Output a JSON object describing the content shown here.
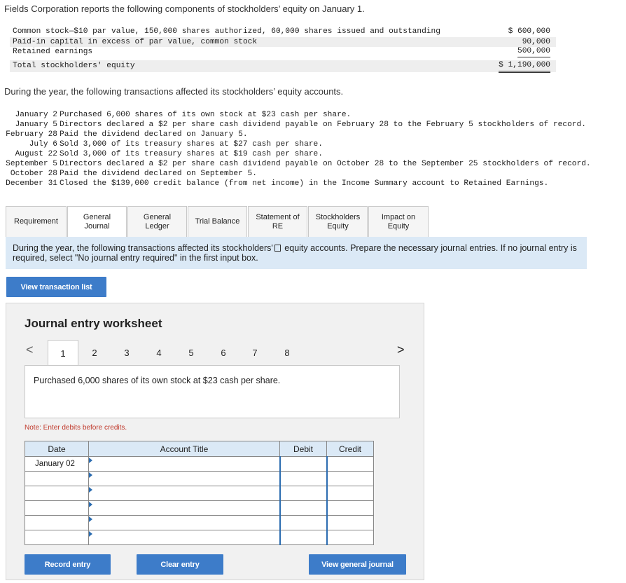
{
  "intro": "Fields Corporation reports the following components of stockholders’ equity on January 1.",
  "equity": [
    {
      "label": "Common stock—$10 par value, 150,000 shares authorized, 60,000 shares issued and outstanding",
      "amount": "$ 600,000"
    },
    {
      "label": "Paid-in capital in excess of par value, common stock",
      "amount": "90,000"
    },
    {
      "label": "Retained earnings",
      "amount": "500,000"
    },
    {
      "label": "Total stockholders' equity",
      "amount": "$ 1,190,000"
    }
  ],
  "during_text": "During the year, the following transactions affected its stockholders’ equity accounts.",
  "transactions": [
    {
      "date": "January 2",
      "text": "Purchased 6,000 shares of its own stock at $23 cash per share."
    },
    {
      "date": "January 5",
      "text": "Directors declared a $2 per share cash dividend payable on February 28 to the February 5 stockholders of record."
    },
    {
      "date": "February 28",
      "text": "Paid the dividend declared on January 5."
    },
    {
      "date": "July 6",
      "text": "Sold 3,000 of its treasury shares at $27 cash per share."
    },
    {
      "date": "August 22",
      "text": "Sold 3,000 of its treasury shares at $19 cash per share."
    },
    {
      "date": "September 5",
      "text": "Directors declared a $2 per share cash dividend payable on October 28 to the September 25 stockholders of record."
    },
    {
      "date": "October 28",
      "text": "Paid the dividend declared on September 5."
    },
    {
      "date": "December 31",
      "text": "Closed the $139,000 credit balance (from net income) in the Income Summary account to Retained Earnings."
    }
  ],
  "tabs": [
    {
      "line1": "Requirement",
      "line2": ""
    },
    {
      "line1": "General",
      "line2": "Journal"
    },
    {
      "line1": "General",
      "line2": "Ledger"
    },
    {
      "line1": "Trial Balance",
      "line2": ""
    },
    {
      "line1": "Statement of",
      "line2": "RE"
    },
    {
      "line1": "Stockholders",
      "line2": "Equity"
    },
    {
      "line1": "Impact on",
      "line2": "Equity"
    }
  ],
  "instruction": {
    "before": "During the year, the following transactions affected its stockholders'",
    "after": " equity accounts.  Prepare the necessary journal entries.  If no journal entry is required, select \"No journal entry required\" in the first input box."
  },
  "buttons": {
    "view_transactions": "View transaction list",
    "record": "Record entry",
    "clear": "Clear entry",
    "view_journal": "View general journal"
  },
  "worksheet": {
    "title": "Journal entry worksheet",
    "pages": [
      "1",
      "2",
      "3",
      "4",
      "5",
      "6",
      "7",
      "8"
    ],
    "active_page": "1",
    "nav_prev": "<",
    "nav_next": ">",
    "description": "Purchased 6,000 shares of its own stock at $23 cash per share.",
    "note": "Note: Enter debits before credits.",
    "headers": {
      "date": "Date",
      "account": "Account Title",
      "debit": "Debit",
      "credit": "Credit"
    },
    "rows": [
      {
        "date": "January 02"
      },
      {
        "date": ""
      },
      {
        "date": ""
      },
      {
        "date": ""
      },
      {
        "date": ""
      },
      {
        "date": ""
      }
    ]
  },
  "colors": {
    "accent": "#3d7cc9",
    "info_bg": "#dbe9f6",
    "note": "#c0392b"
  }
}
